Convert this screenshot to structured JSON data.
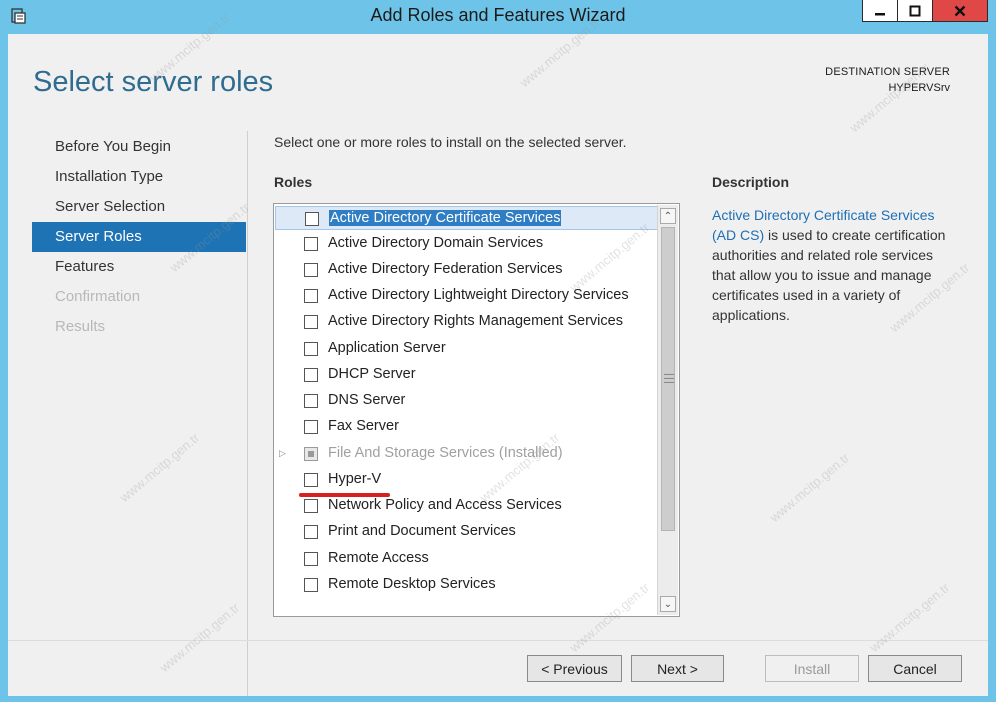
{
  "window": {
    "title": "Add Roles and Features Wizard"
  },
  "page": {
    "title": "Select server roles",
    "destination_label": "DESTINATION SERVER",
    "destination_server": "HYPERVSrv"
  },
  "nav": {
    "items": [
      {
        "label": "Before You Begin",
        "state": "normal"
      },
      {
        "label": "Installation Type",
        "state": "normal"
      },
      {
        "label": "Server Selection",
        "state": "normal"
      },
      {
        "label": "Server Roles",
        "state": "active"
      },
      {
        "label": "Features",
        "state": "normal"
      },
      {
        "label": "Confirmation",
        "state": "disabled"
      },
      {
        "label": "Results",
        "state": "disabled"
      }
    ]
  },
  "main": {
    "instruction": "Select one or more roles to install on the selected server.",
    "roles_heading": "Roles",
    "roles": [
      {
        "label": "Active Directory Certificate Services",
        "checked": false,
        "selected": true
      },
      {
        "label": "Active Directory Domain Services",
        "checked": false
      },
      {
        "label": "Active Directory Federation Services",
        "checked": false
      },
      {
        "label": "Active Directory Lightweight Directory Services",
        "checked": false
      },
      {
        "label": "Active Directory Rights Management Services",
        "checked": false
      },
      {
        "label": "Application Server",
        "checked": false
      },
      {
        "label": "DHCP Server",
        "checked": false
      },
      {
        "label": "DNS Server",
        "checked": false
      },
      {
        "label": "Fax Server",
        "checked": false
      },
      {
        "label": "File And Storage Services (Installed)",
        "checked": "partial",
        "disabled": true,
        "expandable": true
      },
      {
        "label": "Hyper-V",
        "checked": false,
        "annotated": true
      },
      {
        "label": "Network Policy and Access Services",
        "checked": false
      },
      {
        "label": "Print and Document Services",
        "checked": false
      },
      {
        "label": "Remote Access",
        "checked": false
      },
      {
        "label": "Remote Desktop Services",
        "checked": false
      }
    ],
    "description_heading": "Description",
    "description_link": "Active Directory Certificate Services (AD CS)",
    "description_text": " is used to create certification authorities and related role services that allow you to issue and manage certificates used in a variety of applications."
  },
  "buttons": {
    "previous": "< Previous",
    "next": "Next >",
    "install": "Install",
    "cancel": "Cancel"
  },
  "watermark": "www.mcitp.gen.tr",
  "colors": {
    "window_frame": "#6ec4e8",
    "accent": "#1e73b4",
    "title_text": "#2f6c8f",
    "annotation": "#d81e1e",
    "close_button": "#e04848"
  }
}
